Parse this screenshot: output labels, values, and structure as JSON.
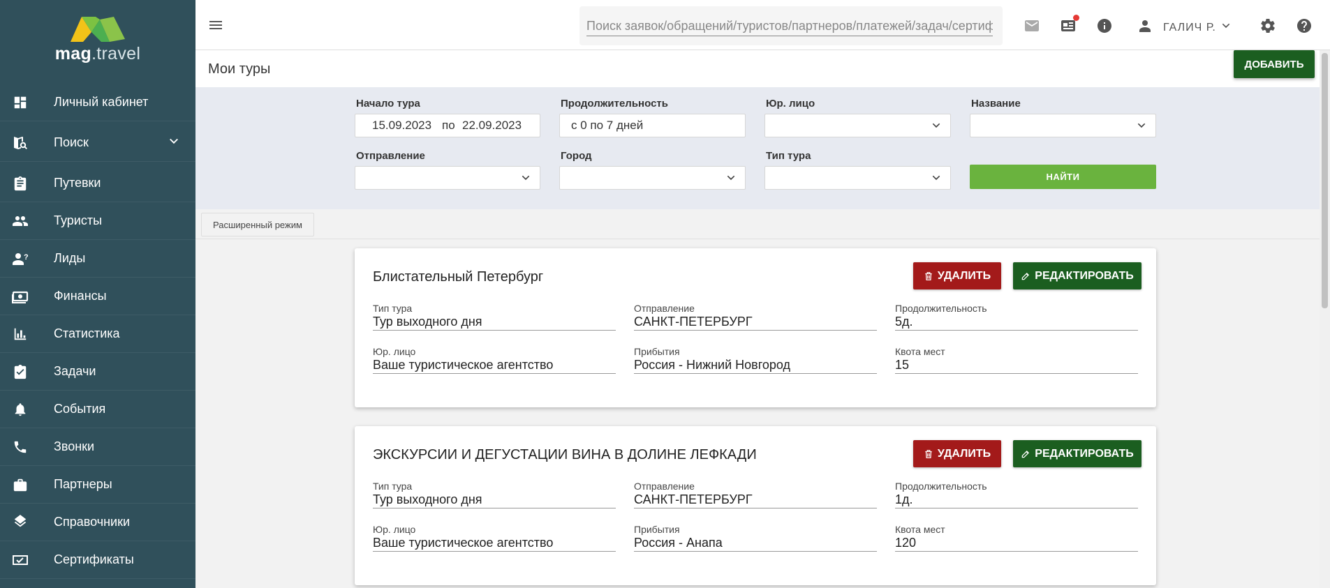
{
  "sidebar": {
    "logo": {
      "bold": "mag",
      "light": ".travel"
    },
    "items": [
      {
        "label": "Личный кабинет",
        "icon": "dashboard-icon"
      },
      {
        "label": "Поиск",
        "icon": "map-search-icon",
        "expandable": true
      },
      {
        "label": "Путевки",
        "icon": "clipboard-icon"
      },
      {
        "label": "Туристы",
        "icon": "people-icon"
      },
      {
        "label": "Лиды",
        "icon": "person-question-icon"
      },
      {
        "label": "Финансы",
        "icon": "money-icon"
      },
      {
        "label": "Статистика",
        "icon": "bar-chart-icon"
      },
      {
        "label": "Задачи",
        "icon": "task-check-icon"
      },
      {
        "label": "События",
        "icon": "bell-icon"
      },
      {
        "label": "Звонки",
        "icon": "phone-icon"
      },
      {
        "label": "Партнеры",
        "icon": "briefcase-icon"
      },
      {
        "label": "Справочники",
        "icon": "layers-icon"
      },
      {
        "label": "Сертификаты",
        "icon": "certificate-icon"
      }
    ]
  },
  "topbar": {
    "search_placeholder": "Поиск заявок/обращений/туристов/партнеров/платежей/задач/сертификатов",
    "user_name": "ГАЛИЧ Р."
  },
  "page": {
    "title": "Мои туры",
    "add_label": "ДОБАВИТЬ"
  },
  "filters": {
    "start_label": "Начало тура",
    "start_from": "15.09.2023",
    "start_sep": "по",
    "start_to": "22.09.2023",
    "duration_label": "Продолжительность",
    "duration_value": "с 0 по 7 дней",
    "legal_label": "Юр. лицо",
    "legal_value": "",
    "name_label": "Название",
    "name_value": "",
    "departure_label": "Отправление",
    "departure_value": "",
    "city_label": "Город",
    "city_value": "",
    "tour_type_label": "Тип тура",
    "tour_type_value": "",
    "find_label": "НАЙТИ",
    "extended_label": "Расширенный режим"
  },
  "card_actions": {
    "delete": "УДАЛИТЬ",
    "edit": "РЕДАКТИРОВАТЬ"
  },
  "field_labels": {
    "tour_type": "Тип тура",
    "departure": "Отправление",
    "duration": "Продолжительность",
    "legal": "Юр. лицо",
    "arrival": "Прибытия",
    "quota": "Квота мест"
  },
  "tours": [
    {
      "title": "Блистательный Петербург",
      "tour_type": "Тур выходного дня",
      "departure": "САНКТ-ПЕТЕРБУРГ",
      "duration": "5д.",
      "legal": "Ваше туристическое агентство",
      "arrival": "Россия - Нижний Новгород",
      "quota": "15"
    },
    {
      "title": "ЭКСКУРСИИ И ДЕГУСТАЦИИ ВИНА В ДОЛИНЕ ЛЕФКАДИ",
      "tour_type": "Тур выходного дня",
      "departure": "САНКТ-ПЕТЕРБУРГ",
      "duration": "1д.",
      "legal": "Ваше туристическое агентство",
      "arrival": "Россия - Анапа",
      "quota": "120"
    }
  ],
  "colors": {
    "sidebar_bg": "#30505b",
    "primary_green": "#1b5e20",
    "find_green": "#6ab33e",
    "delete_red": "#a31a1a",
    "filter_bg": "#e7eaf1"
  }
}
